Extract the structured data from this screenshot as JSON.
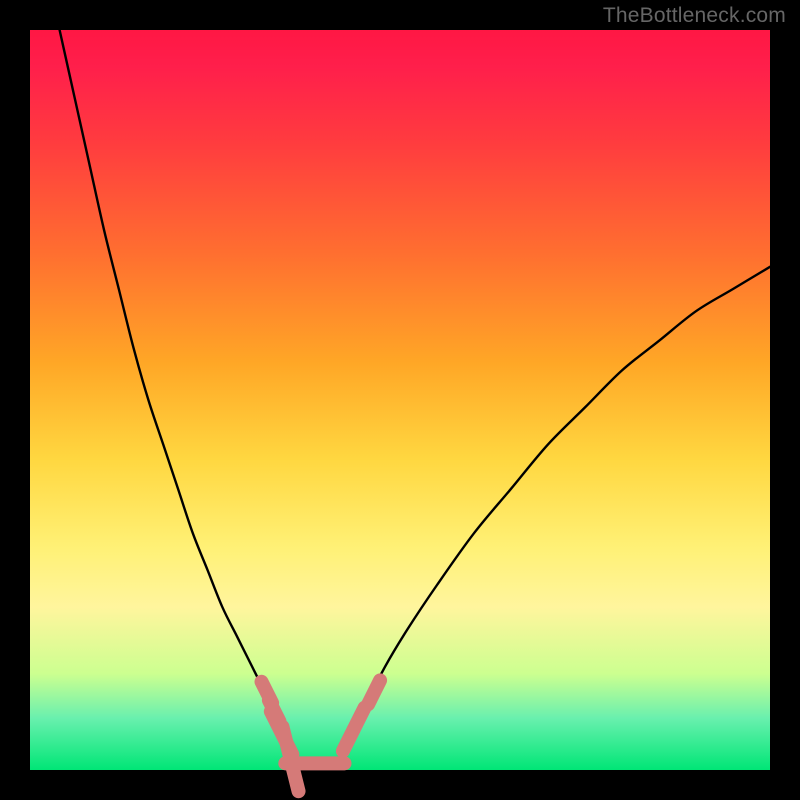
{
  "watermark": "TheBottleneck.com",
  "chart_data": {
    "type": "line",
    "title": "",
    "xlabel": "",
    "ylabel": "",
    "xlim": [
      0,
      100
    ],
    "ylim": [
      0,
      100
    ],
    "series": [
      {
        "name": "left-curve",
        "x": [
          4,
          6,
          8,
          10,
          12,
          14,
          16,
          18,
          20,
          22,
          24,
          26,
          28,
          30,
          32,
          33,
          34,
          35,
          35.5
        ],
        "y": [
          100,
          91,
          82,
          73,
          65,
          57,
          50,
          44,
          38,
          32,
          27,
          22,
          18,
          14,
          10,
          8,
          6,
          4,
          2
        ]
      },
      {
        "name": "right-curve",
        "x": [
          42,
          43,
          44,
          46,
          48,
          51,
          55,
          60,
          65,
          70,
          75,
          80,
          85,
          90,
          95,
          100
        ],
        "y": [
          2,
          4,
          6,
          10,
          14,
          19,
          25,
          32,
          38,
          44,
          49,
          54,
          58,
          62,
          65,
          68
        ]
      }
    ],
    "floor_segment": {
      "x": [
        35.5,
        42
      ],
      "y": [
        0.5,
        0.5
      ]
    },
    "left_markers": [
      {
        "x": 32.0,
        "y": 10.5,
        "len": 3.2
      },
      {
        "x": 33.0,
        "y": 8.0,
        "len": 3.2
      },
      {
        "x": 34.0,
        "y": 5.0,
        "len": 6.5
      },
      {
        "x": 35.2,
        "y": 1.5,
        "len": 9.0
      }
    ],
    "right_markers": [
      {
        "x": 43.0,
        "y": 4.0,
        "len": 3.2
      },
      {
        "x": 44.5,
        "y": 7.0,
        "len": 3.2
      },
      {
        "x": 46.5,
        "y": 10.5,
        "len": 3.6
      }
    ],
    "marker_color": "#d57a78",
    "curve_color": "#000000",
    "gradient_stops": [
      {
        "pct": 0,
        "color": "#ff1744"
      },
      {
        "pct": 50,
        "color": "#ffca28"
      },
      {
        "pct": 100,
        "color": "#00e676"
      }
    ]
  }
}
